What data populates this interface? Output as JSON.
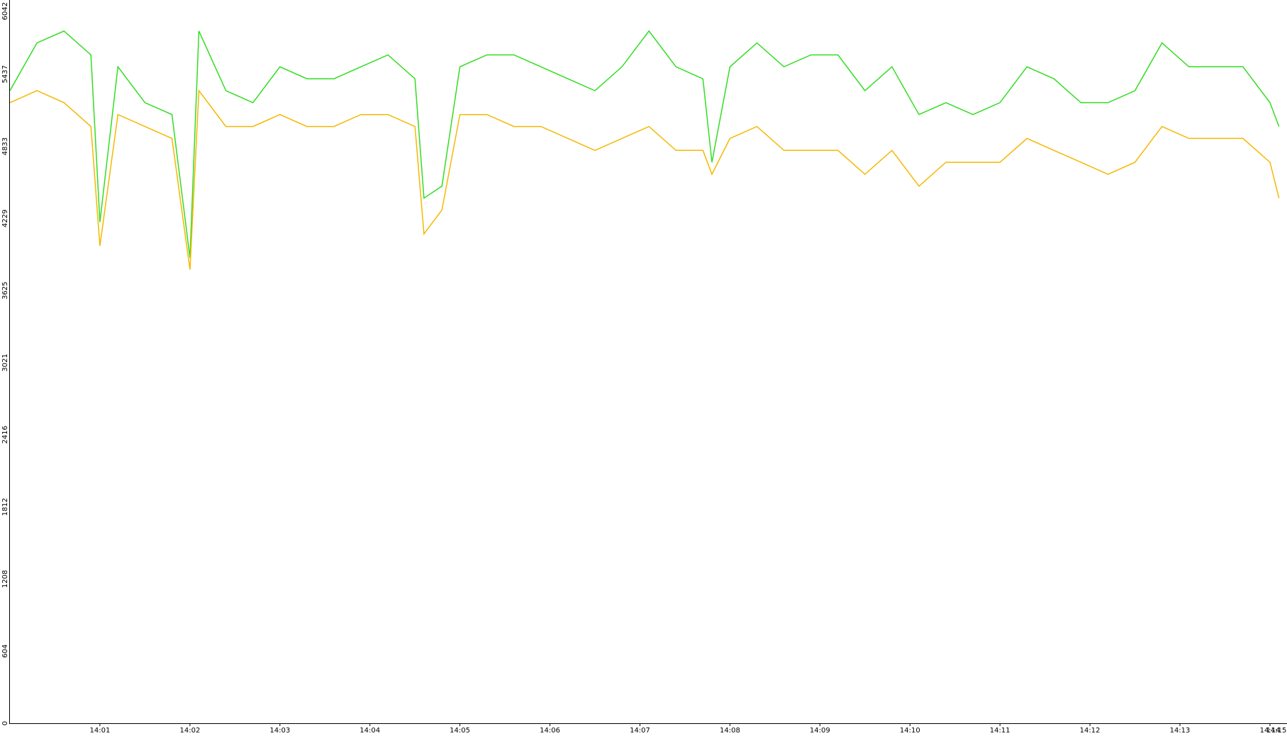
{
  "chart_data": {
    "type": "line",
    "title": "",
    "xlabel": "",
    "ylabel": "",
    "ylim": [
      0,
      6042
    ],
    "y_ticks": [
      "0",
      "604",
      "1208",
      "1812",
      "2416",
      "3021",
      "3625",
      "4229",
      "4833",
      "5437",
      "6042"
    ],
    "x_ticks": [
      "14:01",
      "14:02",
      "14:03",
      "14:04",
      "14:05",
      "14:06",
      "14:07",
      "14:08",
      "14:09",
      "14:10",
      "14:11",
      "14:12",
      "14:13",
      "14:14",
      "14:15"
    ],
    "x_range_minutes": [
      0,
      14.15
    ],
    "grid": false,
    "legend": "none",
    "colors": {
      "axis": "#000000",
      "background": "#ffffff"
    },
    "series": [
      {
        "color": "#33dd22",
        "x": [
          0.0,
          0.3,
          0.6,
          0.9,
          1.0,
          1.2,
          1.5,
          1.8,
          2.0,
          2.1,
          2.4,
          2.7,
          3.0,
          3.3,
          3.6,
          3.9,
          4.2,
          4.5,
          4.6,
          4.8,
          5.0,
          5.3,
          5.6,
          5.9,
          6.2,
          6.5,
          6.8,
          7.1,
          7.4,
          7.7,
          7.8,
          8.0,
          8.3,
          8.6,
          8.9,
          9.2,
          9.5,
          9.8,
          10.1,
          10.4,
          10.7,
          11.0,
          11.3,
          11.6,
          11.9,
          12.2,
          12.5,
          12.8,
          13.1,
          13.4,
          13.7,
          14.0,
          14.1
        ],
        "values": [
          5300,
          5700,
          5800,
          5600,
          4200,
          5500,
          5200,
          5100,
          3900,
          5800,
          5300,
          5200,
          5500,
          5400,
          5400,
          5500,
          5600,
          5400,
          4400,
          4500,
          5500,
          5600,
          5600,
          5500,
          5400,
          5300,
          5500,
          5800,
          5500,
          5400,
          4700,
          5500,
          5700,
          5500,
          5600,
          5600,
          5300,
          5500,
          5100,
          5200,
          5100,
          5200,
          5500,
          5400,
          5200,
          5200,
          5300,
          5700,
          5500,
          5500,
          5500,
          5200,
          5000
        ]
      },
      {
        "color": "#f5b800",
        "x": [
          0.0,
          0.3,
          0.6,
          0.9,
          1.0,
          1.2,
          1.5,
          1.8,
          2.0,
          2.1,
          2.4,
          2.7,
          3.0,
          3.3,
          3.6,
          3.9,
          4.2,
          4.5,
          4.6,
          4.8,
          5.0,
          5.3,
          5.6,
          5.9,
          6.2,
          6.5,
          6.8,
          7.1,
          7.4,
          7.7,
          7.8,
          8.0,
          8.3,
          8.6,
          8.9,
          9.2,
          9.5,
          9.8,
          10.1,
          10.4,
          10.7,
          11.0,
          11.3,
          11.6,
          11.9,
          12.2,
          12.5,
          12.8,
          13.1,
          13.4,
          13.7,
          14.0,
          14.1
        ],
        "values": [
          5200,
          5300,
          5200,
          5000,
          4000,
          5100,
          5000,
          4900,
          3800,
          5300,
          5000,
          5000,
          5100,
          5000,
          5000,
          5100,
          5100,
          5000,
          4100,
          4300,
          5100,
          5100,
          5000,
          5000,
          4900,
          4800,
          4900,
          5000,
          4800,
          4800,
          4600,
          4900,
          5000,
          4800,
          4800,
          4800,
          4600,
          4800,
          4500,
          4700,
          4700,
          4700,
          4900,
          4800,
          4700,
          4600,
          4700,
          5000,
          4900,
          4900,
          4900,
          4700,
          4400
        ]
      }
    ]
  }
}
